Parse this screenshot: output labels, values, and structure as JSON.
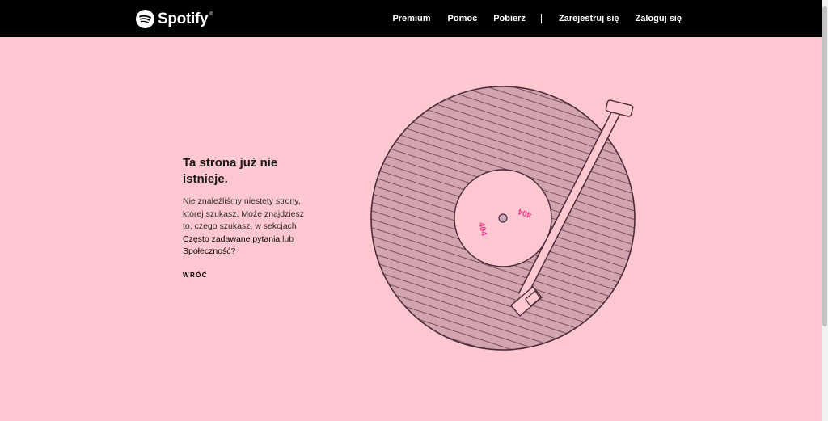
{
  "header": {
    "logo_text": "Spotify",
    "logo_tm": "®",
    "nav": {
      "premium": "Premium",
      "help": "Pomoc",
      "download": "Pobierz",
      "signup": "Zarejestruj się",
      "login": "Zaloguj się"
    }
  },
  "error": {
    "title": "Ta strona już nie istnieje.",
    "desc_part1": "Nie znaleźliśmy niestety strony, której szukasz. Może znajdziesz to, czego szukasz, w sekcjach ",
    "faq_link": "Często zadawane pytania",
    "desc_part2": " lub ",
    "community_link": "Społeczność",
    "desc_part3": "?",
    "back_label": "WRÓĆ"
  },
  "record": {
    "label_text": "404"
  },
  "colors": {
    "background": "#ffc7cf",
    "header": "#000000",
    "record": "#d4a4ae",
    "record_stroke": "#4b2a3a",
    "label": "#ffc7cf",
    "label_text": "#f0388a"
  },
  "icons": {
    "logo": "spotify-logo-icon"
  }
}
